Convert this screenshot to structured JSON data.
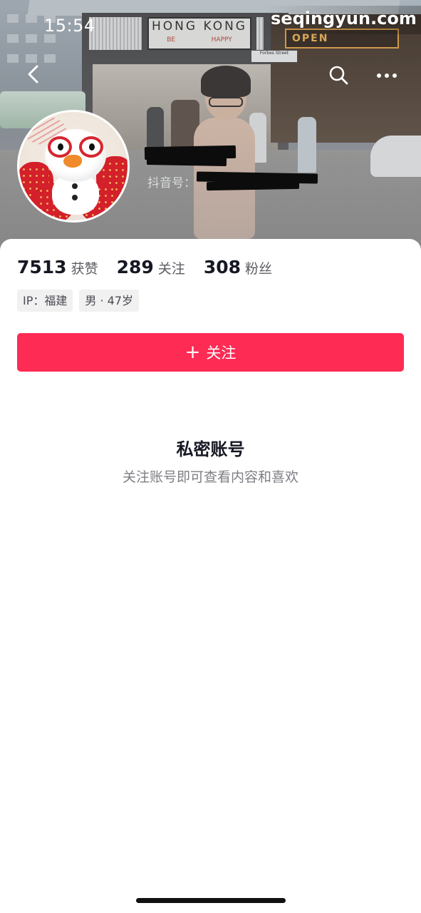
{
  "status_bar": {
    "time": "15:54"
  },
  "watermark": "seqingyun.com",
  "cover": {
    "sign_main": "HONG KONG",
    "sign_left": "BE",
    "sign_right": "HAPPY",
    "neon_sign": "OPEN",
    "street_sign": "Forbes Street"
  },
  "nav": {
    "back_icon": "chevron-left-icon",
    "search_icon": "search-icon",
    "more_icon": "more-horizontal-icon"
  },
  "profile": {
    "douyin_id_label": "抖音号："
  },
  "stats": [
    {
      "value": "7513",
      "label": "获赞"
    },
    {
      "value": "289",
      "label": "关注"
    },
    {
      "value": "308",
      "label": "粉丝"
    }
  ],
  "tags": [
    "IP：福建",
    "男 · 47岁"
  ],
  "follow_button": {
    "icon": "+",
    "label": "关注"
  },
  "private": {
    "title": "私密账号",
    "subtitle": "关注账号即可查看内容和喜欢"
  },
  "colors": {
    "accent": "#fe2c55",
    "text_primary": "#161823",
    "text_secondary": "#7d7e84",
    "tag_bg": "#f1f1f2"
  }
}
